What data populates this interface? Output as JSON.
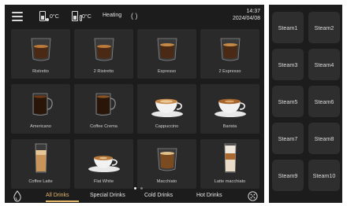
{
  "header": {
    "tank1_temp": "0°C",
    "tank2_temp": "0°C",
    "status": "Heating",
    "time": "14:37",
    "date": "2024/04/08"
  },
  "drinks": [
    {
      "label": "Ristretto",
      "icon": "double-glass-espresso-icon"
    },
    {
      "label": "2 Ristretto",
      "icon": "double-glass-espresso-icon"
    },
    {
      "label": "Espresso",
      "icon": "double-glass-espresso-icon"
    },
    {
      "label": "2 Espresso",
      "icon": "double-glass-espresso-icon"
    },
    {
      "label": "Americano",
      "icon": "mug-icon"
    },
    {
      "label": "Coffee Crema",
      "icon": "mug-icon"
    },
    {
      "label": "Cappuccino",
      "icon": "cup-saucer-icon"
    },
    {
      "label": "Barista",
      "icon": "cup-saucer-icon"
    },
    {
      "label": "Coffee Latte",
      "icon": "tall-glass-icon"
    },
    {
      "label": "Flat White",
      "icon": "cup-saucer-icon"
    },
    {
      "label": "Macchiato",
      "icon": "double-glass-icon"
    },
    {
      "label": "Latte macchiato",
      "icon": "tall-glass-icon"
    }
  ],
  "tabs": [
    {
      "label": "All Drinks",
      "active": true
    },
    {
      "label": "Special Drinks",
      "active": false
    },
    {
      "label": "Cold Drinks",
      "active": false
    },
    {
      "label": "Hot Drinks",
      "active": false
    }
  ],
  "pager": {
    "pages": 2,
    "current": 1
  },
  "steam_buttons": [
    "Steam1",
    "Steam2",
    "Steam3",
    "Steam4",
    "Steam5",
    "Steam6",
    "Steam7",
    "Steam8",
    "Steam9",
    "Steam10"
  ],
  "colors": {
    "accent": "#e3b86a",
    "panel": "#1c1c1c",
    "tile": "#2a2a2a",
    "steam_button": "#2e2e2e"
  }
}
